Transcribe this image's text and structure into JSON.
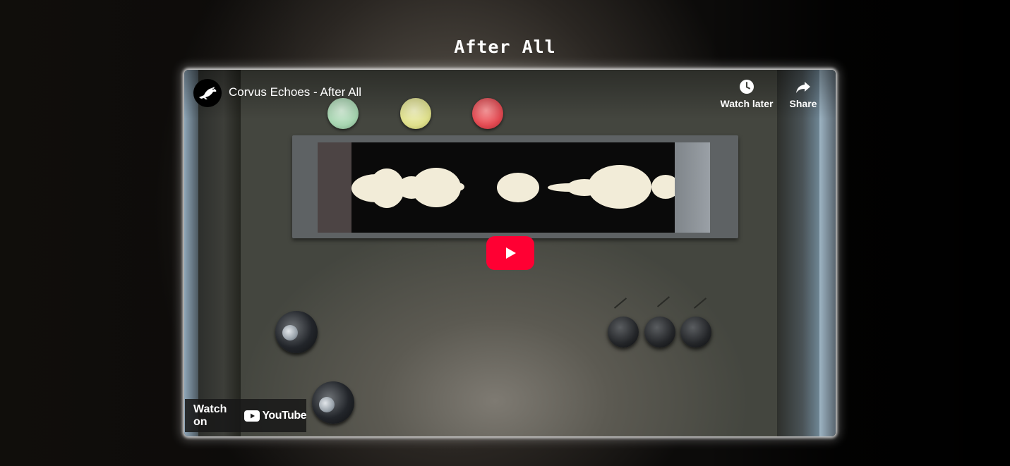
{
  "page": {
    "title": "After All"
  },
  "video": {
    "title": "Corvus Echoes - After All",
    "watch_later_label": "Watch later",
    "share_label": "Share",
    "watch_on_label": "Watch on",
    "youtube_label": "YouTube"
  },
  "colors": {
    "play_button": "#ff0033",
    "lamp_green": "#a6d4b0",
    "lamp_yellow": "#dfe08c",
    "lamp_red": "#e24a52",
    "waveform": "#f2ecd8"
  },
  "icons": {
    "channel_avatar": "crow-icon",
    "watch_later": "clock-icon",
    "share": "share-arrow-icon",
    "play": "play-icon",
    "youtube_logo": "youtube-logo-icon"
  }
}
